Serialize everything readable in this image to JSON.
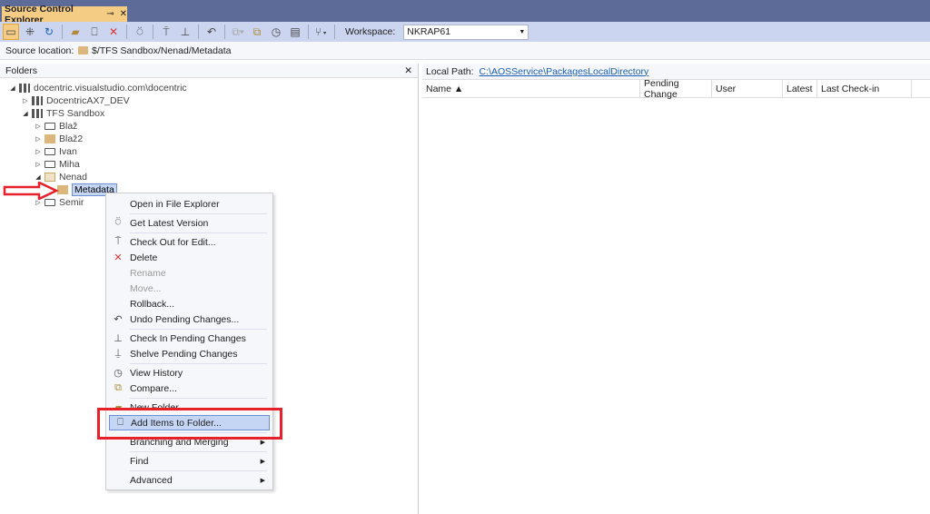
{
  "tab": {
    "title": "Source Control Explorer",
    "pin": "⊸",
    "close": "✕"
  },
  "toolbar": {
    "workspace_label": "Workspace:",
    "workspace_value": "NKRAP61"
  },
  "source_location": {
    "label": "Source location:",
    "path": "$/TFS Sandbox/Nenad/Metadata"
  },
  "folders": {
    "title": "Folders",
    "close": "✕",
    "tree": [
      {
        "label": "docentric.visualstudio.com\\docentric"
      },
      {
        "label": "DocentricAX7_DEV"
      },
      {
        "label": "TFS Sandbox"
      },
      {
        "label": "Blaž"
      },
      {
        "label": "Blaž2"
      },
      {
        "label": "Ivan"
      },
      {
        "label": "Miha"
      },
      {
        "label": "Nenad"
      },
      {
        "label": "Metadata"
      },
      {
        "label": "Semir"
      }
    ]
  },
  "right": {
    "local_path_label": "Local Path:",
    "local_path": "C:\\AOSService\\PackagesLocalDirectory",
    "columns": [
      "Name ▲",
      "Pending Change",
      "User",
      "Latest",
      "Last Check-in"
    ]
  },
  "context_menu": {
    "items": [
      "Open in File Explorer",
      "Get Latest Version",
      "Check Out for Edit...",
      "Delete",
      "Rename",
      "Move...",
      "Rollback...",
      "Undo Pending Changes...",
      "Check In Pending Changes",
      "Shelve Pending Changes",
      "View History",
      "Compare...",
      "New Folder",
      "Add Items to Folder...",
      "Branching and Merging",
      "Find",
      "Advanced"
    ]
  },
  "colors": {
    "accent": "#5d6b99",
    "tab": "#f5cc84",
    "highlight": "#e8202a"
  }
}
